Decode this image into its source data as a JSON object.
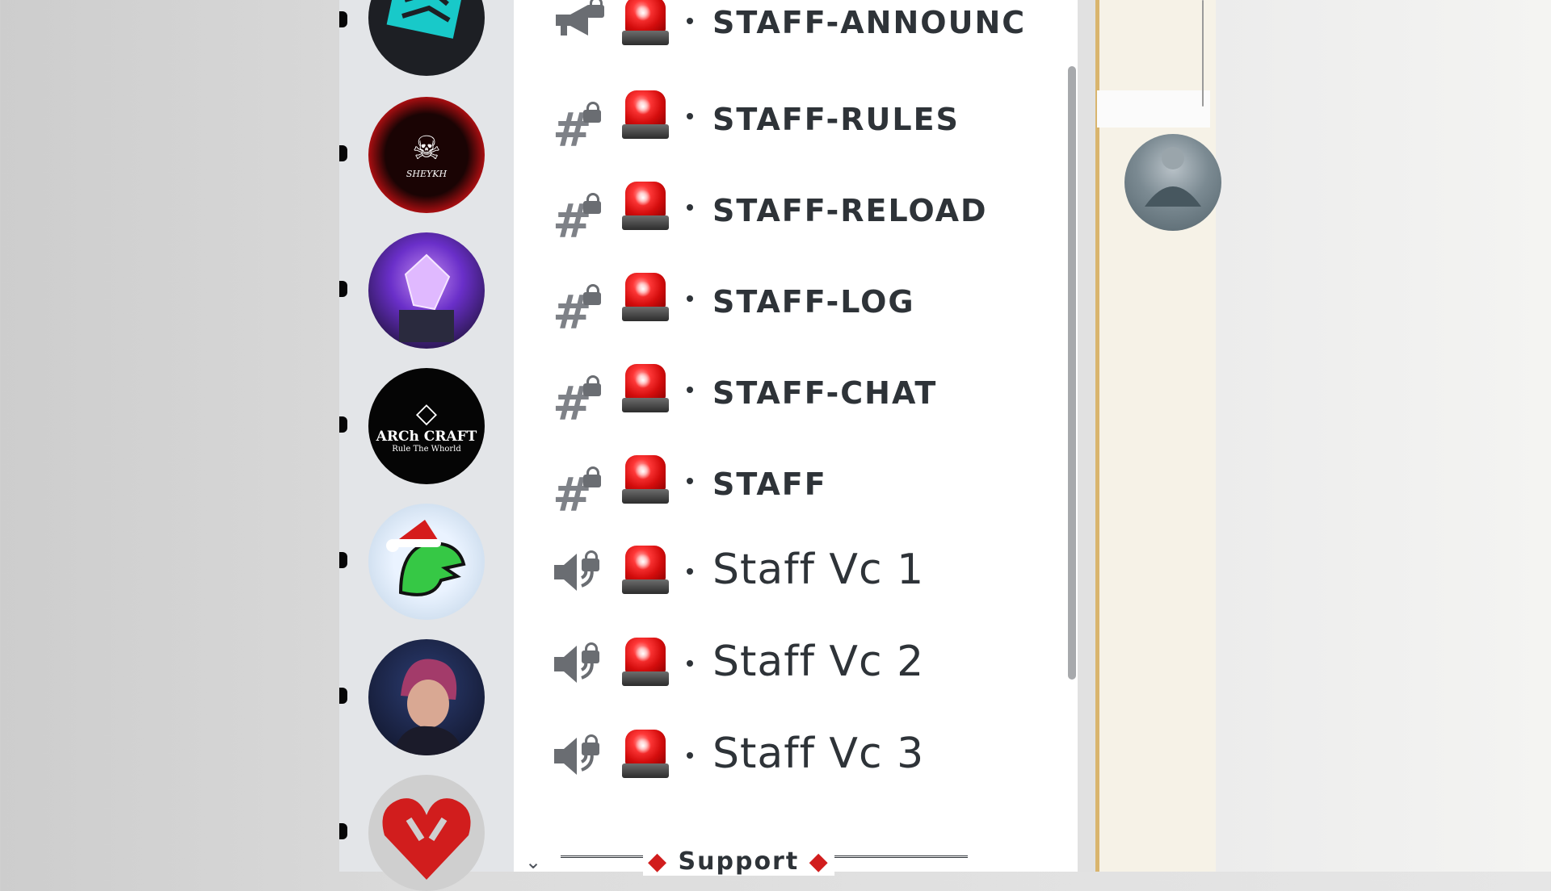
{
  "servers": [
    {
      "name": "server-maze"
    },
    {
      "name": "server-sheykh",
      "text": "SHEYKH"
    },
    {
      "name": "server-crystal"
    },
    {
      "name": "server-archcraft",
      "title": "ARCh CRAFT",
      "subtitle": "Rule The Whorld"
    },
    {
      "name": "server-dino"
    },
    {
      "name": "server-anime"
    },
    {
      "name": "server-heart"
    }
  ],
  "channels": [
    {
      "icon": "announcement-lock-icon",
      "name": "STAFF-ANNOUNC",
      "type": "text"
    },
    {
      "icon": "hashtag-lock-icon",
      "name": "STAFF-RULES",
      "type": "text"
    },
    {
      "icon": "hashtag-lock-icon",
      "name": "STAFF-RELOAD",
      "type": "text"
    },
    {
      "icon": "hashtag-lock-icon",
      "name": "STAFF-LOG",
      "type": "text"
    },
    {
      "icon": "hashtag-lock-icon",
      "name": "STAFF-CHAT",
      "type": "text"
    },
    {
      "icon": "hashtag-lock-icon",
      "name": "STAFF",
      "type": "text"
    },
    {
      "icon": "voice-lock-icon",
      "name": "Staff Vc 1",
      "type": "voice"
    },
    {
      "icon": "voice-lock-icon",
      "name": "Staff Vc 2",
      "type": "voice"
    },
    {
      "icon": "voice-lock-icon",
      "name": "Staff Vc 3",
      "type": "voice"
    }
  ],
  "category": {
    "label": "Support"
  },
  "colors": {
    "siren": "#e01b1b",
    "text": "#2e3338",
    "icon": "#6a6d72"
  }
}
